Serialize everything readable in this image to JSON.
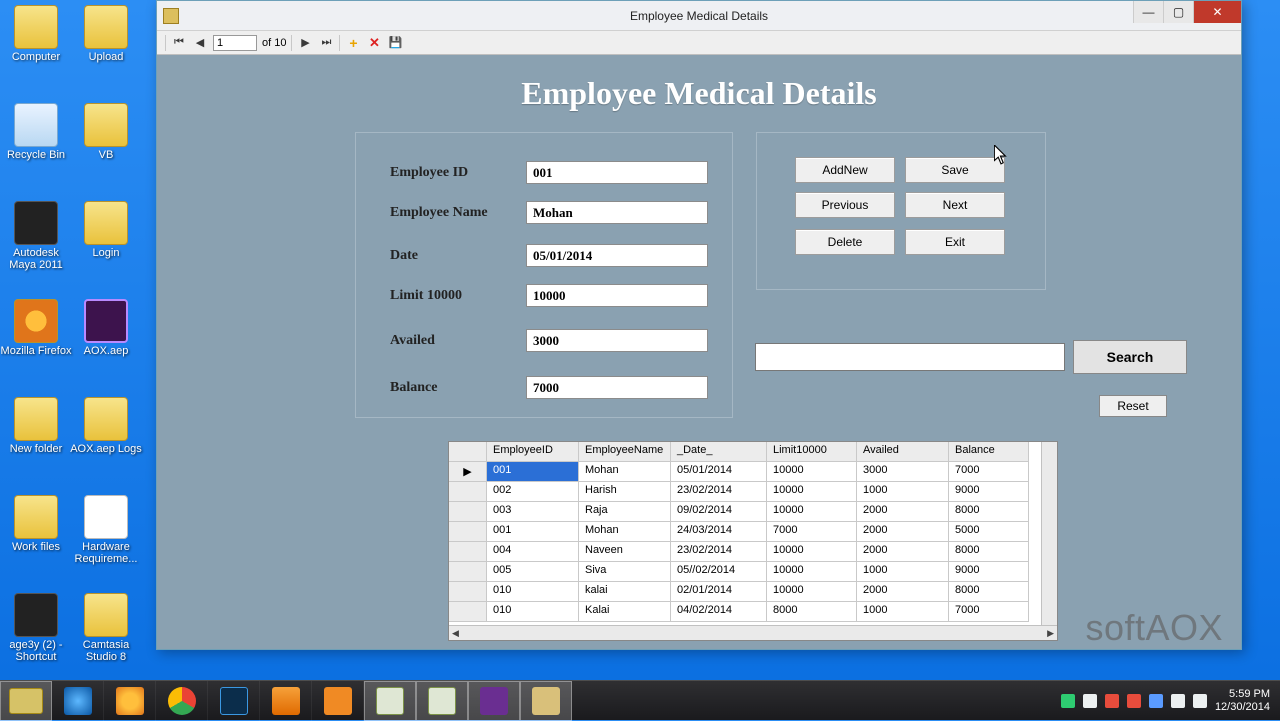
{
  "desktop": {
    "icons": [
      {
        "label": "Computer",
        "cls": ""
      },
      {
        "label": "Upload",
        "cls": ""
      },
      {
        "label": "Recycle Bin",
        "cls": "bin"
      },
      {
        "label": "VB",
        "cls": ""
      },
      {
        "label": "Autodesk Maya 2011",
        "cls": "dark"
      },
      {
        "label": "Login",
        "cls": ""
      },
      {
        "label": "Mozilla Firefox",
        "cls": "ff"
      },
      {
        "label": "AOX.aep",
        "cls": "ae"
      },
      {
        "label": "New folder",
        "cls": ""
      },
      {
        "label": "AOX.aep Logs",
        "cls": ""
      },
      {
        "label": "Work files",
        "cls": ""
      },
      {
        "label": "Hardware Requireme...",
        "cls": "file"
      },
      {
        "label": "age3y (2) - Shortcut",
        "cls": "dark"
      },
      {
        "label": "Camtasia Studio 8",
        "cls": ""
      }
    ]
  },
  "window": {
    "title": "Employee Medical Details",
    "nav": {
      "pos": "1",
      "of_label": "of 10"
    }
  },
  "page": {
    "heading": "Employee Medical Details",
    "labels": {
      "emp_id": "Employee ID",
      "emp_name": "Employee Name",
      "date": "Date",
      "limit": "Limit 10000",
      "availed": "Availed",
      "balance": "Balance"
    },
    "fields": {
      "emp_id": "001",
      "emp_name": "Mohan",
      "date": "05/01/2014",
      "limit": "10000",
      "availed": "3000",
      "balance": "7000"
    },
    "buttons": {
      "addnew": "AddNew",
      "save": "Save",
      "previous": "Previous",
      "next": "Next",
      "delete": "Delete",
      "exit": "Exit",
      "search": "Search",
      "reset": "Reset"
    },
    "search_value": ""
  },
  "grid": {
    "columns": [
      "EmployeeID",
      "EmployeeName",
      "_Date_",
      "Limit10000",
      "Availed",
      "Balance"
    ],
    "rows": [
      {
        "id": "001",
        "name": "Mohan",
        "date": "05/01/2014",
        "limit": "10000",
        "availed": "3000",
        "balance": "7000",
        "selected": true
      },
      {
        "id": "002",
        "name": "Harish",
        "date": "23/02/2014",
        "limit": "10000",
        "availed": "1000",
        "balance": "9000"
      },
      {
        "id": "003",
        "name": "Raja",
        "date": "09/02/2014",
        "limit": "10000",
        "availed": "2000",
        "balance": "8000"
      },
      {
        "id": "001",
        "name": "Mohan",
        "date": "24/03/2014",
        "limit": "7000",
        "availed": "2000",
        "balance": "5000"
      },
      {
        "id": "004",
        "name": "Naveen",
        "date": "23/02/2014",
        "limit": "10000",
        "availed": "2000",
        "balance": "8000"
      },
      {
        "id": "005",
        "name": "Siva",
        "date": "05//02/2014",
        "limit": "10000",
        "availed": "1000",
        "balance": "9000"
      },
      {
        "id": "010",
        "name": "kalai",
        "date": "02/01/2014",
        "limit": "10000",
        "availed": "2000",
        "balance": "8000"
      },
      {
        "id": "010",
        "name": "Kalai",
        "date": "04/02/2014",
        "limit": "8000",
        "availed": "1000",
        "balance": "7000"
      }
    ]
  },
  "watermark": "softAOX",
  "taskbar": {
    "clock_time": "5:59 PM",
    "clock_date": "12/30/2014"
  }
}
